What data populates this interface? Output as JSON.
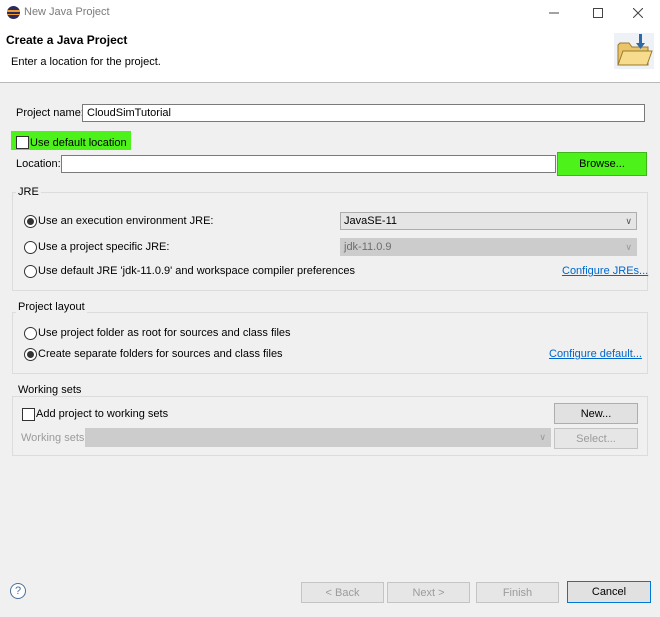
{
  "window": {
    "title": "New Java Project"
  },
  "header": {
    "title": "Create a Java Project",
    "message": "Enter a location for the project."
  },
  "project": {
    "name_label": "Project name:",
    "name_value": "CloudSimTutorial",
    "use_default_label": "Use default location",
    "location_label": "Location:",
    "location_value": "",
    "browse_label": "Browse..."
  },
  "jre": {
    "group_title": "JRE",
    "option_env_label": "Use an execution environment JRE:",
    "env_value": "JavaSE-11",
    "option_specific_label": "Use a project specific JRE:",
    "specific_value": "jdk-11.0.9",
    "option_default_label": "Use default JRE 'jdk-11.0.9' and workspace compiler preferences",
    "configure_link": "Configure JREs..."
  },
  "layout": {
    "group_title": "Project layout",
    "option_root_label": "Use project folder as root for sources and class files",
    "option_separate_label": "Create separate folders for sources and class files",
    "configure_link": "Configure default..."
  },
  "working_sets": {
    "group_title": "Working sets",
    "add_label": "Add project to working sets",
    "new_label": "New...",
    "sets_label": "Working sets:",
    "select_label": "Select..."
  },
  "footer": {
    "back_label": "< Back",
    "next_label": "Next >",
    "finish_label": "Finish",
    "cancel_label": "Cancel"
  },
  "colors": {
    "highlight": "#4cf21a",
    "link": "#0066cc"
  }
}
